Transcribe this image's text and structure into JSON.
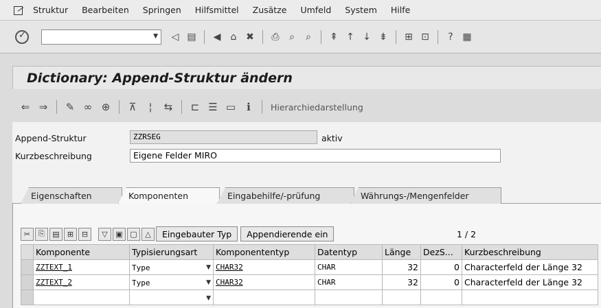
{
  "menu": {
    "items": [
      {
        "label": "Struktur"
      },
      {
        "label": "Bearbeiten"
      },
      {
        "label": "Springen"
      },
      {
        "label": "Hilfsmittel"
      },
      {
        "label": "Zusätze"
      },
      {
        "label": "Umfeld"
      },
      {
        "label": "System"
      },
      {
        "label": "Hilfe"
      }
    ]
  },
  "command_field": {
    "value": ""
  },
  "title": "Dictionary: Append-Struktur ändern",
  "app_toolbar": {
    "hierarchy_label": "Hierarchiedarstellung"
  },
  "header": {
    "append_label": "Append-Struktur",
    "append_value": "ZZRSEG",
    "status": "aktiv",
    "desc_label": "Kurzbeschreibung",
    "desc_value": "Eigene Felder MIRO"
  },
  "tabs": [
    {
      "label": "Eigenschaften"
    },
    {
      "label": "Komponenten",
      "active": true
    },
    {
      "label": "Eingabehilfe/-prüfung"
    },
    {
      "label": "Währungs-/Mengenfelder"
    }
  ],
  "table_toolbar": {
    "builtin_type_label": "Eingebauter Typ",
    "append_label": "Appendierende ein",
    "page_indicator": "1 / 2"
  },
  "table": {
    "columns": [
      "Komponente",
      "Typisierungsart",
      "Komponententyp",
      "Datentyp",
      "Länge",
      "DezS...",
      "Kurzbeschreibung"
    ],
    "rows": [
      [
        "ZZTEXT_1",
        "Type",
        "CHAR32",
        "CHAR",
        "32",
        "0",
        "Characterfeld der Länge 32"
      ],
      [
        "ZZTEXT_2",
        "Type",
        "CHAR32",
        "CHAR",
        "32",
        "0",
        "Characterfeld der Länge 32"
      ],
      [
        "",
        "",
        "",
        "",
        "",
        "",
        ""
      ]
    ]
  },
  "colors": {
    "background": "#dcdcdc",
    "panel": "#f2f2f2",
    "header_cell": "#dedede"
  }
}
